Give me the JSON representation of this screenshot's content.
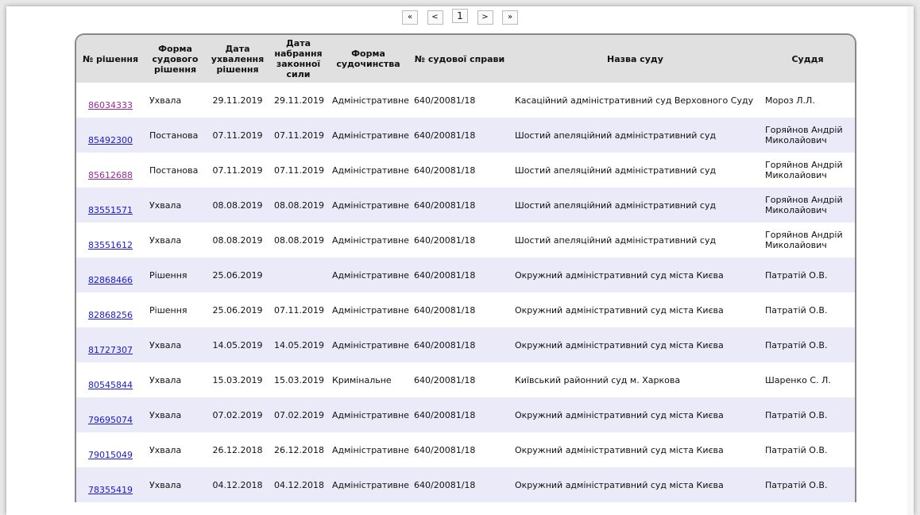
{
  "pager": {
    "first": "«",
    "prev": "<",
    "current": "1",
    "next": ">",
    "last": "»"
  },
  "headers": [
    "№ рішення",
    "Форма судового рішення",
    "Дата ухвалення рішення",
    "Дата набрання законної сили",
    "Форма судочинства",
    "№ судової справи",
    "Назва суду",
    "Суддя"
  ],
  "rows": [
    {
      "num": "86034333",
      "visited": true,
      "form": "Ухвала",
      "date": "29.11.2019",
      "legal": "29.11.2019",
      "proc": "Адміністративне",
      "case": "640/20081/18",
      "court": "Касаційний адміністративний суд Верховного Суду",
      "judge": "Мороз Л.Л."
    },
    {
      "num": "85492300",
      "visited": false,
      "form": "Постанова",
      "date": "07.11.2019",
      "legal": "07.11.2019",
      "proc": "Адміністративне",
      "case": "640/20081/18",
      "court": "Шостий апеляційний адміністративний суд",
      "judge": "Горяйнов Андрій Миколайович"
    },
    {
      "num": "85612688",
      "visited": true,
      "form": "Постанова",
      "date": "07.11.2019",
      "legal": "07.11.2019",
      "proc": "Адміністративне",
      "case": "640/20081/18",
      "court": "Шостий апеляційний адміністративний суд",
      "judge": "Горяйнов Андрій Миколайович"
    },
    {
      "num": "83551571",
      "visited": false,
      "form": "Ухвала",
      "date": "08.08.2019",
      "legal": "08.08.2019",
      "proc": "Адміністративне",
      "case": "640/20081/18",
      "court": "Шостий апеляційний адміністративний суд",
      "judge": "Горяйнов Андрій Миколайович"
    },
    {
      "num": "83551612",
      "visited": false,
      "form": "Ухвала",
      "date": "08.08.2019",
      "legal": "08.08.2019",
      "proc": "Адміністративне",
      "case": "640/20081/18",
      "court": "Шостий апеляційний адміністративний суд",
      "judge": "Горяйнов Андрій Миколайович"
    },
    {
      "num": "82868466",
      "visited": false,
      "form": "Рішення",
      "date": "25.06.2019",
      "legal": "",
      "proc": "Адміністративне",
      "case": "640/20081/18",
      "court": "Окружний адміністративний суд міста Києва",
      "judge": "Патратій О.В."
    },
    {
      "num": "82868256",
      "visited": false,
      "form": "Рішення",
      "date": "25.06.2019",
      "legal": "07.11.2019",
      "proc": "Адміністративне",
      "case": "640/20081/18",
      "court": "Окружний адміністративний суд міста Києва",
      "judge": "Патратій О.В."
    },
    {
      "num": "81727307",
      "visited": false,
      "form": "Ухвала",
      "date": "14.05.2019",
      "legal": "14.05.2019",
      "proc": "Адміністративне",
      "case": "640/20081/18",
      "court": "Окружний адміністративний суд міста Києва",
      "judge": "Патратій О.В."
    },
    {
      "num": "80545844",
      "visited": false,
      "form": "Ухвала",
      "date": "15.03.2019",
      "legal": "15.03.2019",
      "proc": "Кримінальне",
      "case": "640/20081/18",
      "court": "Київський районний суд м. Харкова",
      "judge": "Шаренко С. Л."
    },
    {
      "num": "79695074",
      "visited": false,
      "form": "Ухвала",
      "date": "07.02.2019",
      "legal": "07.02.2019",
      "proc": "Адміністративне",
      "case": "640/20081/18",
      "court": "Окружний адміністративний суд міста Києва",
      "judge": "Патратій О.В."
    },
    {
      "num": "79015049",
      "visited": false,
      "form": "Ухвала",
      "date": "26.12.2018",
      "legal": "26.12.2018",
      "proc": "Адміністративне",
      "case": "640/20081/18",
      "court": "Окружний адміністративний суд міста Києва",
      "judge": "Патратій О.В."
    },
    {
      "num": "78355419",
      "visited": false,
      "form": "Ухвала",
      "date": "04.12.2018",
      "legal": "04.12.2018",
      "proc": "Адміністративне",
      "case": "640/20081/18",
      "court": "Окружний адміністративний суд міста Києва",
      "judge": "Патратій О.В."
    }
  ]
}
